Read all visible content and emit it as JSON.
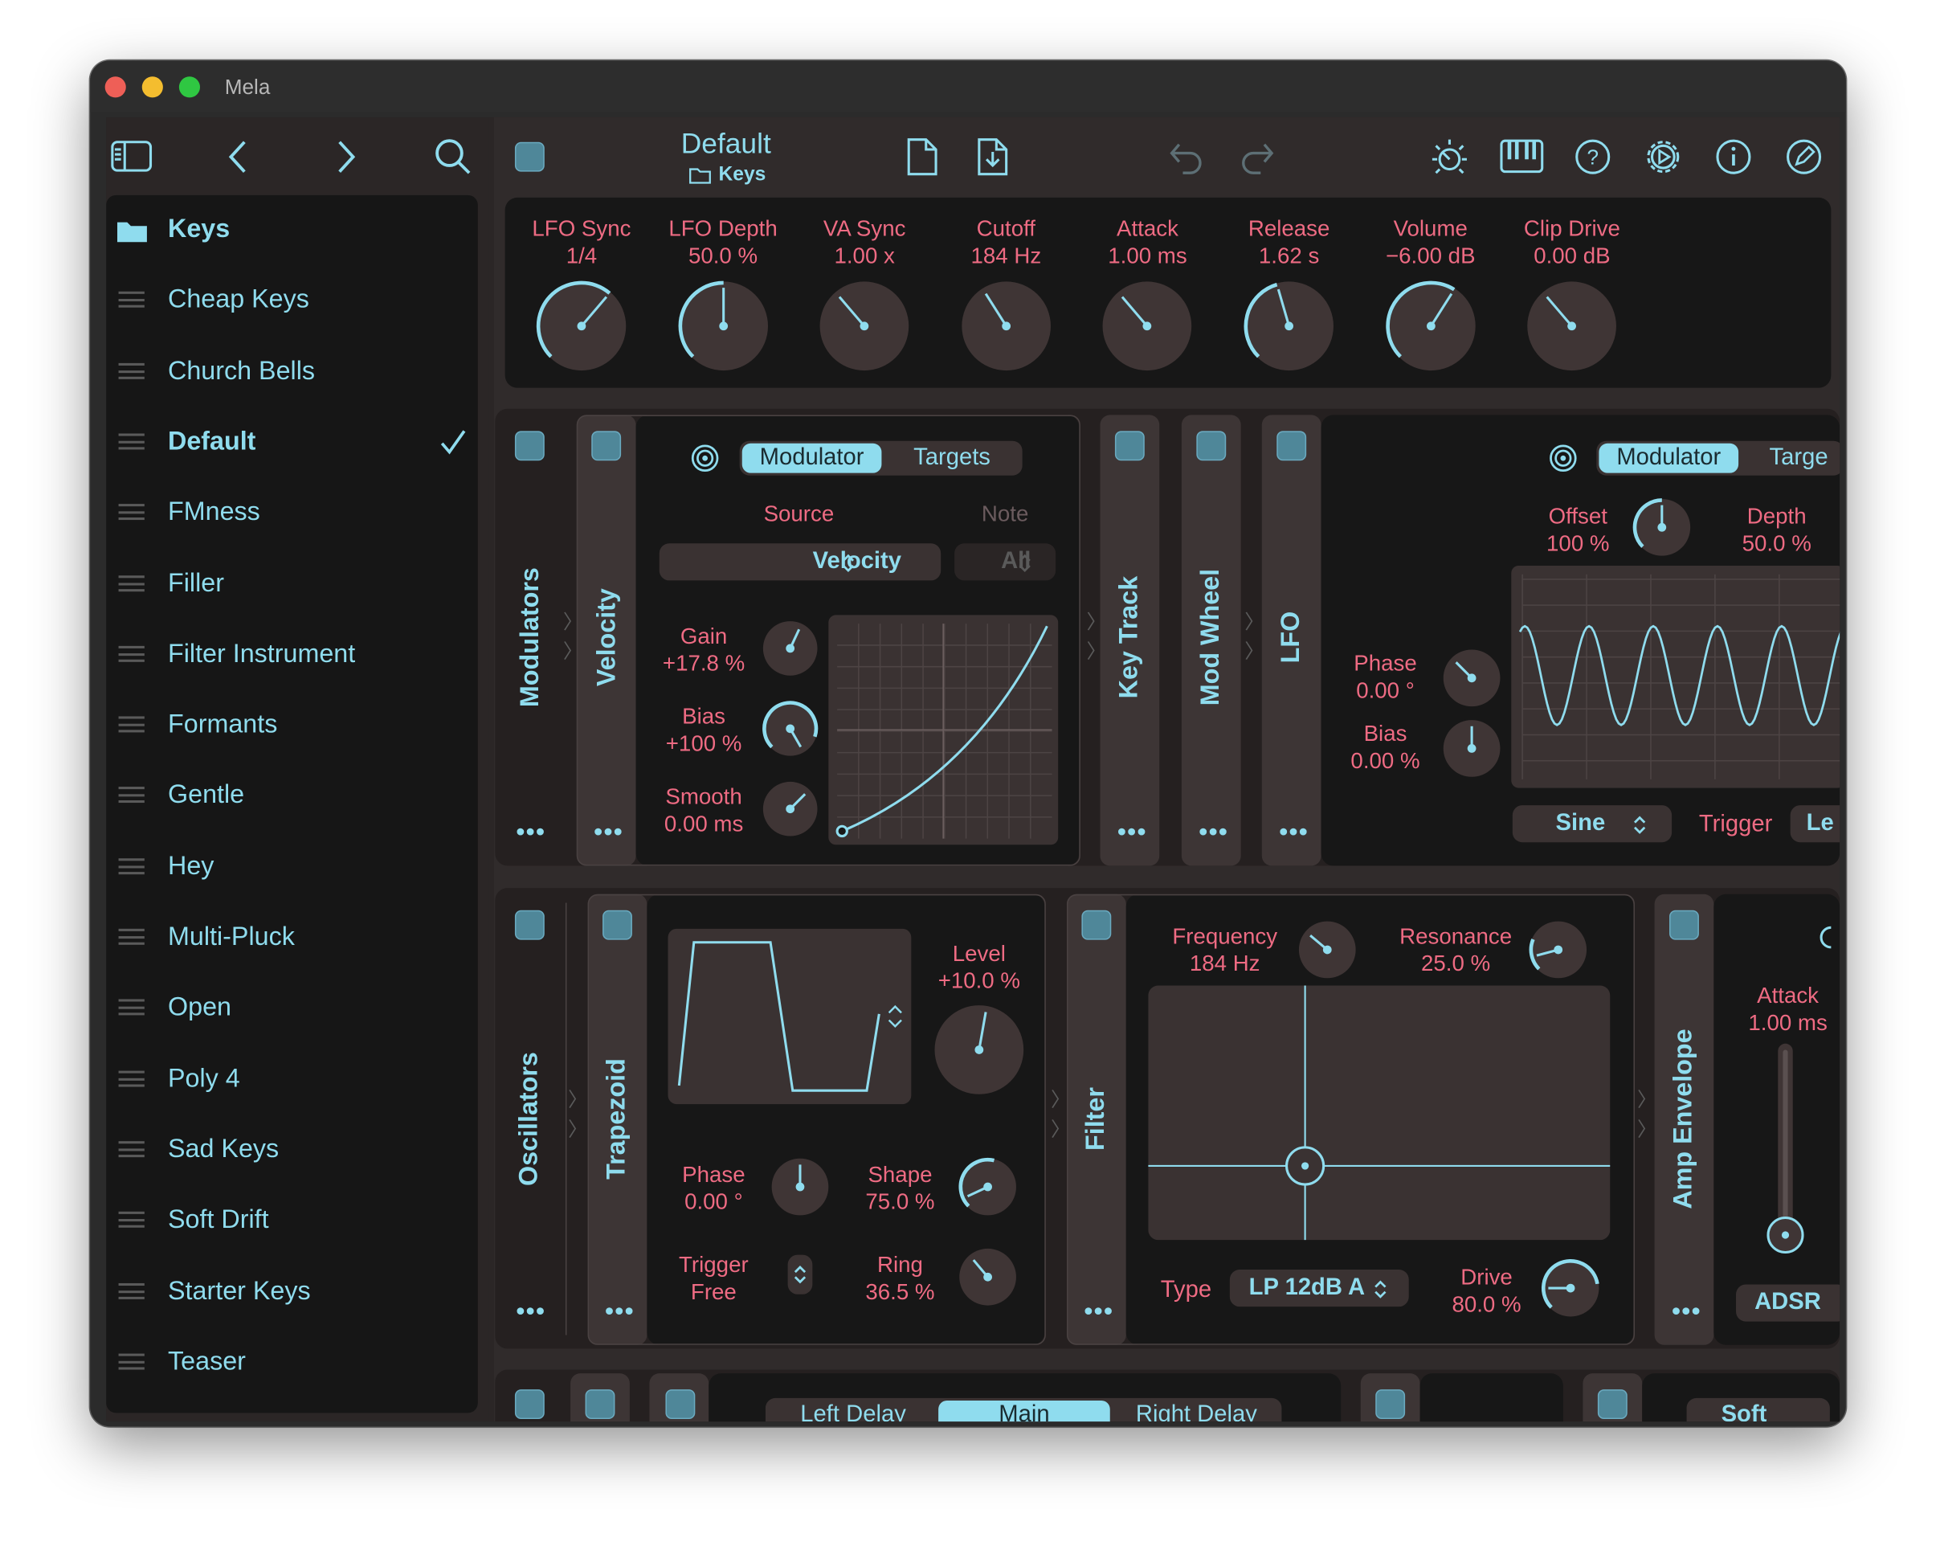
{
  "window": {
    "title": "Mela",
    "traffic": {
      "close": "#ee5f57",
      "min": "#f4bd2f",
      "max": "#2fc742"
    }
  },
  "sidebar": {
    "items": [
      {
        "label": "Keys",
        "icon": "folder-icon",
        "folder": true
      },
      {
        "label": "Cheap Keys"
      },
      {
        "label": "Church Bells"
      },
      {
        "label": "Default",
        "selected": true,
        "checked": true
      },
      {
        "label": "FMness"
      },
      {
        "label": "Filler"
      },
      {
        "label": "Filter Instrument"
      },
      {
        "label": "Formants"
      },
      {
        "label": "Gentle"
      },
      {
        "label": "Hey"
      },
      {
        "label": "Multi-Pluck"
      },
      {
        "label": "Open"
      },
      {
        "label": "Poly 4"
      },
      {
        "label": "Sad Keys"
      },
      {
        "label": "Soft Drift"
      },
      {
        "label": "Starter Keys"
      },
      {
        "label": "Teaser"
      }
    ]
  },
  "header": {
    "preset_name": "Default",
    "folder_name": "Keys"
  },
  "macros": [
    {
      "label": "LFO Sync",
      "value": "1/4",
      "level": 0.65
    },
    {
      "label": "LFO Depth",
      "value": "50.0 %",
      "level": 0.5
    },
    {
      "label": "VA Sync",
      "value": "1.00 x",
      "level": 0.35
    },
    {
      "label": "Cutoff",
      "value": "184 Hz",
      "level": 0.38
    },
    {
      "label": "Attack",
      "value": "1.00 ms",
      "level": 0.35
    },
    {
      "label": "Release",
      "value": "1.62 s",
      "level": 0.44
    },
    {
      "label": "Volume",
      "value": "−6.00 dB",
      "level": 0.62
    },
    {
      "label": "Clip Drive",
      "value": "0.00 dB",
      "level": 0.35
    }
  ],
  "modulators": {
    "title": "Modulators",
    "velocity": {
      "title": "Velocity",
      "tabs": [
        "Modulator",
        "Targets"
      ],
      "source_label": "Source",
      "note_label": "Note",
      "source_value": "Velocity",
      "note_value": "All",
      "gain": {
        "label": "Gain",
        "value": "+17.8 %"
      },
      "bias": {
        "label": "Bias",
        "value": "+100 %"
      },
      "smooth": {
        "label": "Smooth",
        "value": "0.00 ms"
      }
    },
    "key_track": "Key Track",
    "mod_wheel": "Mod Wheel",
    "lfo": {
      "title": "LFO",
      "tabs": [
        "Modulator",
        "Targe"
      ],
      "offset": {
        "label": "Offset",
        "value": "100 %"
      },
      "depth": {
        "label": "Depth",
        "value": "50.0 %"
      },
      "phase": {
        "label": "Phase",
        "value": "0.00 °"
      },
      "bias": {
        "label": "Bias",
        "value": "0.00 %"
      },
      "wave": "Sine",
      "trigger_label": "Trigger",
      "trigger_value": "Le"
    }
  },
  "oscillators": {
    "title": "Oscillators",
    "trapezoid": {
      "title": "Trapezoid",
      "level": {
        "label": "Level",
        "value": "+10.0 %"
      },
      "phase": {
        "label": "Phase",
        "value": "0.00 °"
      },
      "shape": {
        "label": "Shape",
        "value": "75.0 %"
      },
      "trigger": {
        "label": "Trigger",
        "value": "Free"
      },
      "ring": {
        "label": "Ring",
        "value": "36.5 %"
      }
    },
    "filter": {
      "title": "Filter",
      "frequency": {
        "label": "Frequency",
        "value": "184 Hz"
      },
      "resonance": {
        "label": "Resonance",
        "value": "25.0 %"
      },
      "type_label": "Type",
      "type_value": "LP 12dB A",
      "drive": {
        "label": "Drive",
        "value": "80.0 %"
      }
    },
    "amp": {
      "title": "Amp Envelope",
      "attack": {
        "label": "Attack",
        "value": "1.00 ms"
      },
      "mode": "ADSR"
    }
  },
  "effects": {
    "tabs": [
      "Left Delay",
      "Main",
      "Right Delay"
    ],
    "soft": "Soft"
  },
  "colors": {
    "accent": "#8fdcee",
    "label": "#ee6b83",
    "panel": "#171717",
    "knob": "#3f3535"
  }
}
